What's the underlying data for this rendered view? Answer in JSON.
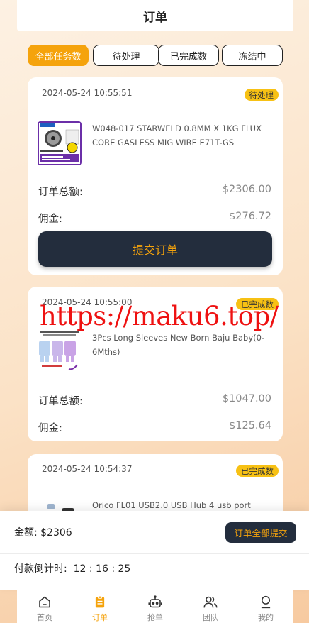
{
  "header": {
    "title": "订单"
  },
  "tabs": [
    {
      "label": "全部任务数",
      "active": true
    },
    {
      "label": "待处理",
      "active": false
    },
    {
      "label": "已完成数",
      "active": false
    },
    {
      "label": "冻结中",
      "active": false
    }
  ],
  "orders": [
    {
      "time": "2024-05-24 10:55:51",
      "status": "待处理",
      "product_name": "W048-017 STARWELD 0.8MM X 1KG FLUX CORE GASLESS MIG WIRE E71T-GS",
      "total_label": "订单总额:",
      "total_value": "$2306.00",
      "commission_label": "佣金:",
      "commission_value": "$276.72",
      "submit_label": "提交订单"
    },
    {
      "time": "2024-05-24 10:55:00",
      "status": "已完成数",
      "product_name": "3Pcs Long Sleeves New Born Baju Baby(0-6Mths)",
      "total_label": "订单总额:",
      "total_value": "$1047.00",
      "commission_label": "佣金:",
      "commission_value": "$125.64"
    },
    {
      "time": "2024-05-24 10:54:37",
      "status": "已完成数",
      "product_name": "Orico FL01 USB2.0 USB Hub 4 usb port"
    }
  ],
  "watermark": "https://maku6.top/",
  "summary": {
    "amount_label": "金额:",
    "amount_value": "$2306",
    "submit_all_label": "订单全部提交",
    "countdown_label": "付款倒计时:",
    "countdown_value": "12 : 16 : 25"
  },
  "tabbar": [
    {
      "label": "首页",
      "icon": "home-icon",
      "active": false
    },
    {
      "label": "订单",
      "icon": "clipboard-icon",
      "active": true
    },
    {
      "label": "抢单",
      "icon": "robot-icon",
      "active": false
    },
    {
      "label": "团队",
      "icon": "team-icon",
      "active": false
    },
    {
      "label": "我的",
      "icon": "user-icon",
      "active": false
    }
  ],
  "colors": {
    "accent": "#f5a30c",
    "dark_button": "#232d3d",
    "badge": "#f7c114",
    "watermark": "#ee1111"
  }
}
